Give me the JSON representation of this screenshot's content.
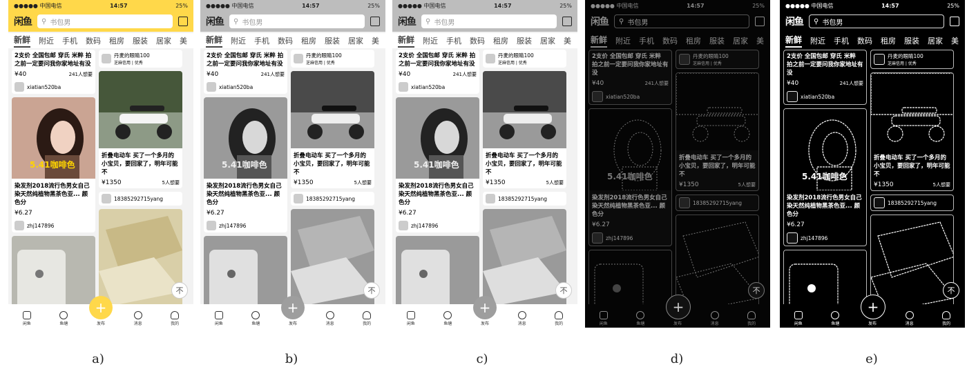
{
  "status": {
    "carrier": "●●●●● 中国电信 ",
    "time": "14:57",
    "battery": "25%"
  },
  "header": {
    "logo": "闲鱼",
    "search_placeholder": "书包男"
  },
  "tabs": [
    "新鲜",
    "附近",
    "手机",
    "数码",
    "租房",
    "服装",
    "居家",
    "美"
  ],
  "cards": {
    "c1_text": "2支价 全国包邮 穿氏 米粹 拍之前一定要问我你家地址有没",
    "c1_price": "¥40",
    "c1_want": "241人想要",
    "c1_user": "xiatian520ba",
    "c2_user": "丹麦的眼睛100",
    "c2_tag": "芝麻信用 | 优秀",
    "photo_overlay": "5.41咖啡色",
    "c3_text": "染发剂2018流行色男女自己染天然纯植物黑茶色亚... 颜色分",
    "c3_price": "¥6.27",
    "c3_user": "zhj147896",
    "c4_text": "折叠电动车 买了一个多月的小宝贝，要回家了，明年可能不",
    "c4_price": "¥1350",
    "c4_want": "5人想要",
    "c4_user": "18385292715yang"
  },
  "tabbar": [
    "闲鱼",
    "鱼塘",
    "发布",
    "消息",
    "我的"
  ],
  "fab": "+",
  "totop": "不",
  "captions": [
    "a)",
    "b)",
    "c)",
    "d)",
    "e)"
  ],
  "colors": {
    "brand_yellow": "#ffd84a",
    "gray_header": "#bdbdbd",
    "dark_bg": "#050505"
  }
}
